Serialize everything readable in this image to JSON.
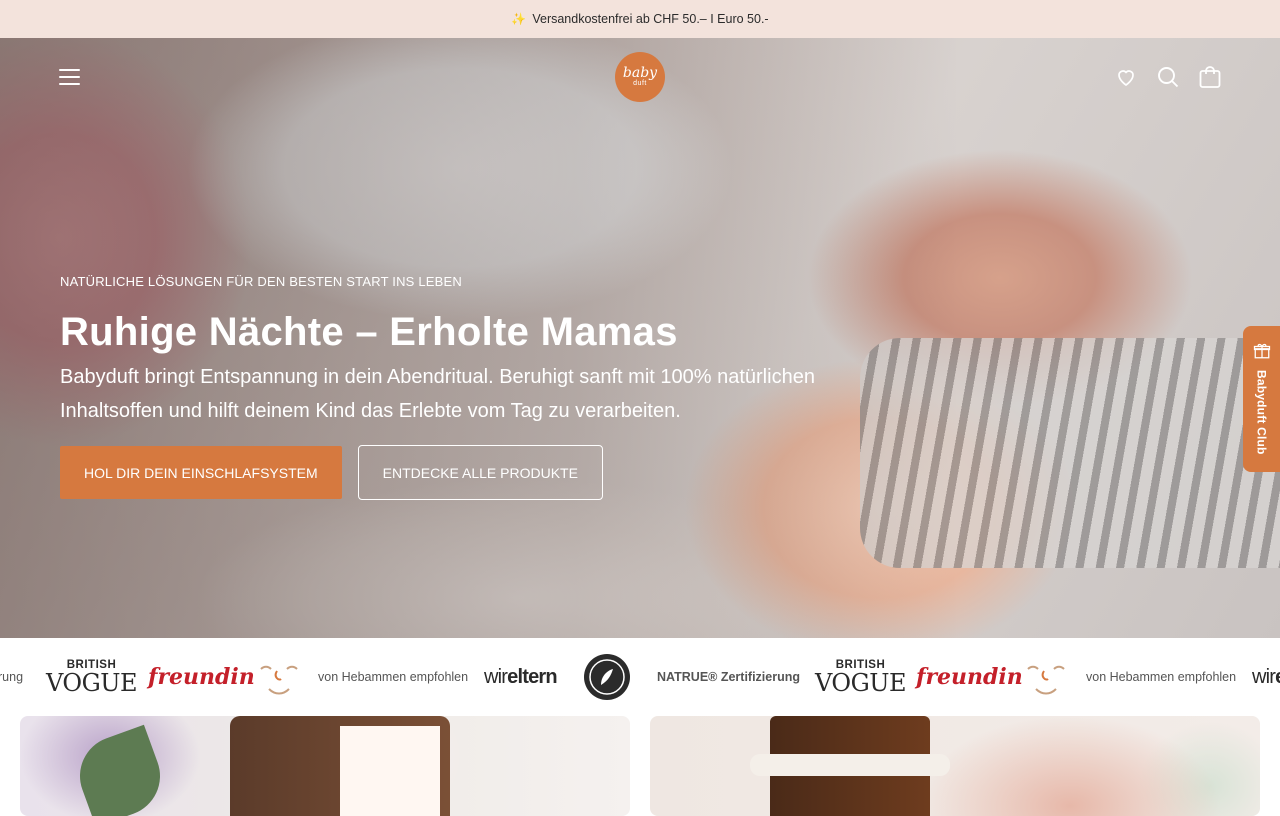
{
  "announcement": {
    "icon": "sparkle-icon",
    "text": "Versandkostenfrei ab CHF 50.– I Euro 50.-"
  },
  "header": {
    "logo_line1": "baby",
    "logo_line2": "duft",
    "icons": [
      "menu-icon",
      "heart-icon",
      "search-icon",
      "shopping-bag-icon"
    ]
  },
  "hero": {
    "eyebrow": "NATÜRLICHE LÖSUNGEN FÜR DEN BESTEN START INS LEBEN",
    "headline": "Ruhige Nächte – Erholte Mamas",
    "subtext": "Babyduft bringt Entspannung in dein Abendritual. Beruhigt sanft mit 100% natürlichen Inhaltsoffen und hilft deinem Kind das Erlebte vom Tag zu verarbeiten.",
    "primary_cta": "HOL DIR DEIN EINSCHLAFSYSTEM",
    "secondary_cta": "ENTDECKE ALLE PRODUKTE"
  },
  "club_tab": {
    "label": "Babyduft Club",
    "icon": "gift-icon"
  },
  "press_strip": {
    "cut_left": "rung",
    "vogue_top": "BRITISH",
    "vogue_main": "VOGUE",
    "freundin": "freundin",
    "hebammen": "von Hebammen empfohlen",
    "wir": "wir",
    "eltern": "eltern",
    "natrue": "NATRUE® Zertifizierung",
    "cut_right_wir": "wir",
    "cut_right_e": "e"
  },
  "colors": {
    "accent": "#d6793f",
    "announcement_bg": "#f3e3dc",
    "freundin_red": "#c4202a"
  }
}
